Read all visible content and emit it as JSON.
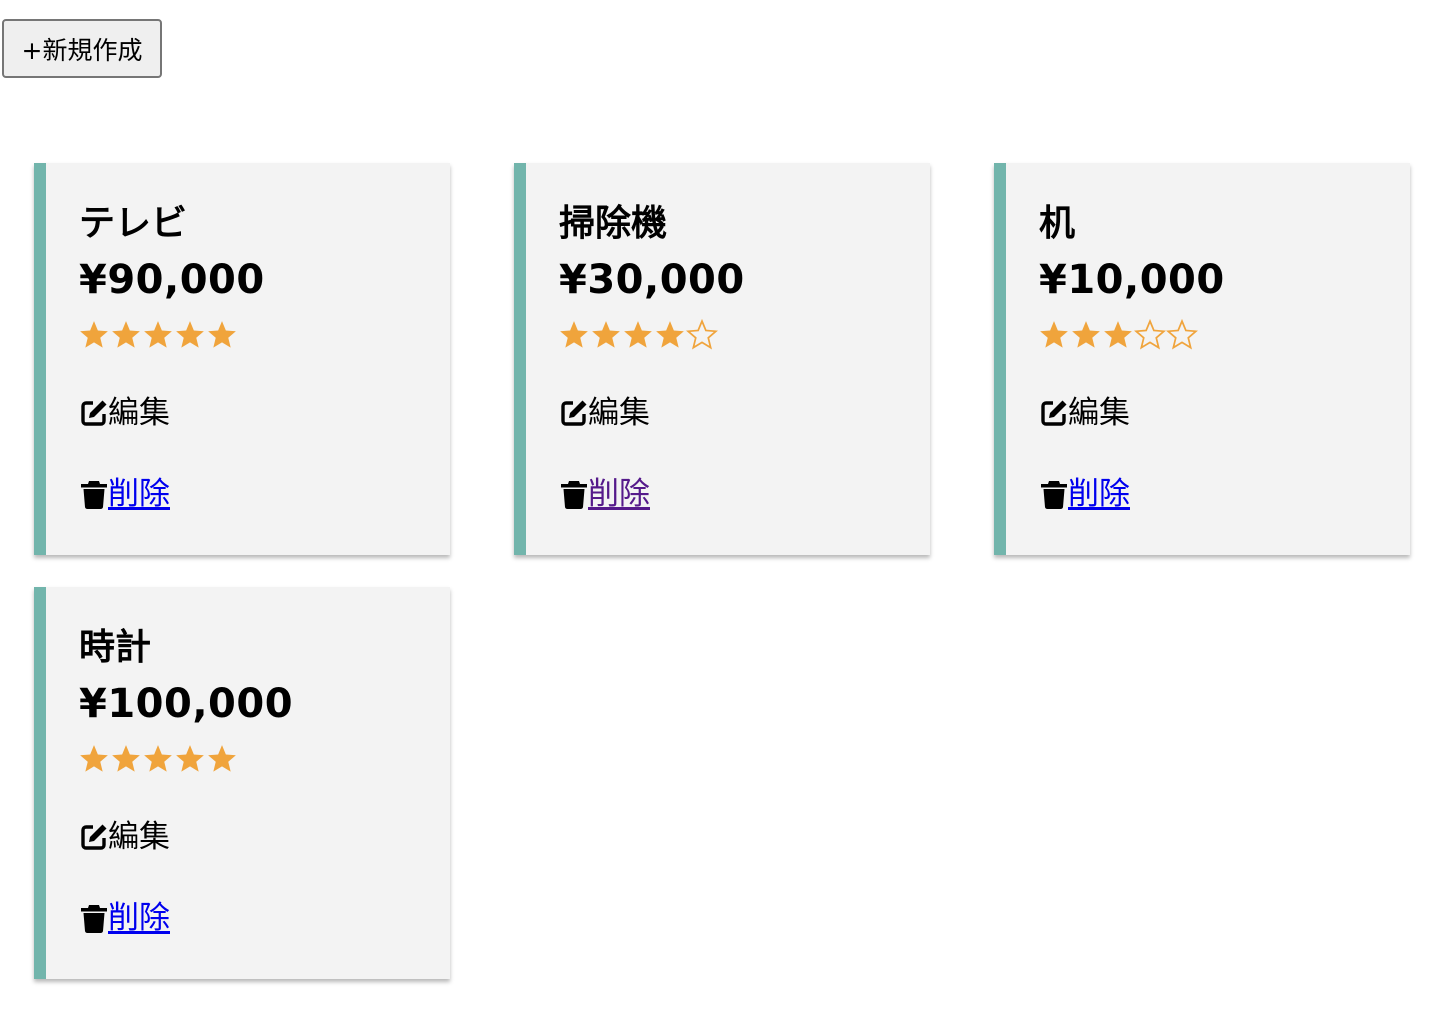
{
  "toolbar": {
    "new_label": "+新規作成"
  },
  "colors": {
    "card_accent": "#72b5ac",
    "star": "#f0a43c",
    "link": "#0000ee",
    "link_visited": "#551a8b"
  },
  "icons": {
    "edit": "pen-square-icon",
    "delete": "trash-icon",
    "star_filled": "star-filled-icon",
    "star_empty": "star-outline-icon"
  },
  "items": [
    {
      "name": "テレビ",
      "price": "¥90,000",
      "rating": 5,
      "edit_label": "編集",
      "delete_label": "削除",
      "delete_visited": false
    },
    {
      "name": "掃除機",
      "price": "¥30,000",
      "rating": 4,
      "edit_label": "編集",
      "delete_label": "削除",
      "delete_visited": true
    },
    {
      "name": "机",
      "price": "¥10,000",
      "rating": 3,
      "edit_label": "編集",
      "delete_label": "削除",
      "delete_visited": false
    },
    {
      "name": "時計",
      "price": "¥100,000",
      "rating": 5,
      "edit_label": "編集",
      "delete_label": "削除",
      "delete_visited": false
    }
  ]
}
